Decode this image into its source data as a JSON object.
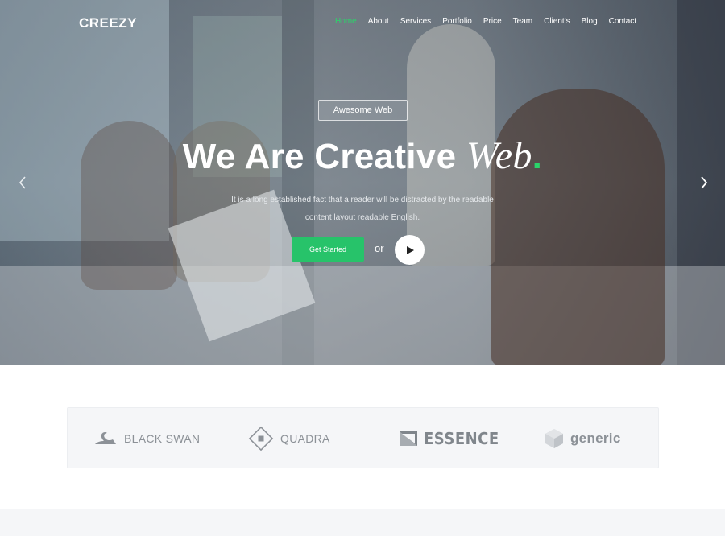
{
  "brand": {
    "name": "CREEZY",
    "accent_color": "#2bd46a"
  },
  "nav": {
    "items": [
      {
        "label": "Home",
        "active": true
      },
      {
        "label": "About",
        "active": false
      },
      {
        "label": "Services",
        "active": false
      },
      {
        "label": "Portfolio",
        "active": false
      },
      {
        "label": "Price",
        "active": false
      },
      {
        "label": "Team",
        "active": false
      },
      {
        "label": "Client's",
        "active": false
      },
      {
        "label": "Blog",
        "active": false
      },
      {
        "label": "Contact",
        "active": false
      }
    ]
  },
  "hero": {
    "badge": "Awesome Web",
    "headline_main": "We Are Creative ",
    "headline_script": "Web",
    "headline_dot": ".",
    "subtitle_line1": "It is a long established fact that a reader will be distracted by the readable",
    "subtitle_line2": "content layout readable English.",
    "cta_label": "Get Started",
    "or_label": "or",
    "play_icon": "play-icon",
    "prev_icon": "chevron-left-icon",
    "next_icon": "chevron-right-icon"
  },
  "clients": [
    {
      "name": "BLACK SWAN",
      "icon": "swan-icon"
    },
    {
      "name": "QUADRA",
      "icon": "diamond-square-icon"
    },
    {
      "name": "ESSENCE",
      "icon": "flag-icon"
    },
    {
      "name": "generic",
      "icon": "cube-icon"
    }
  ],
  "colors": {
    "cta": "#27c36a",
    "client_text": "#8c9197",
    "clients_bg": "#f5f6f8"
  }
}
